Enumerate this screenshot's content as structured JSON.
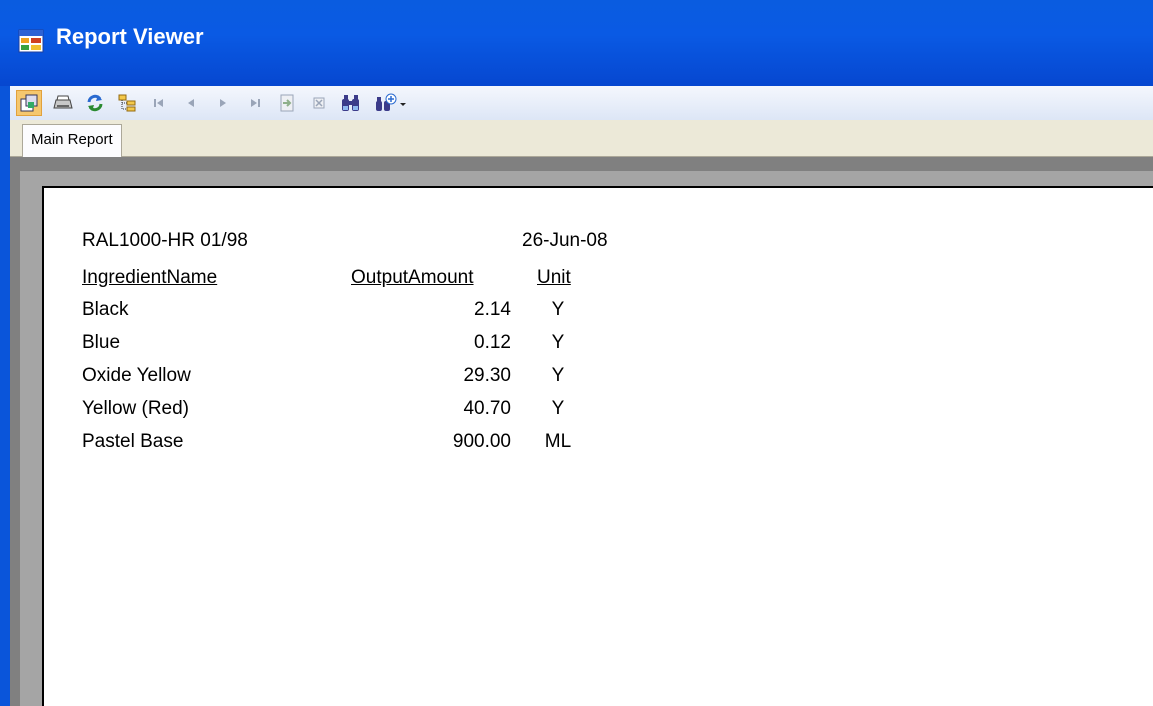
{
  "window": {
    "title": "Report Viewer"
  },
  "toolbar": {
    "buttons": [
      "export-icon",
      "print-icon",
      "refresh-icon",
      "group-tree-icon",
      "first-page-icon",
      "previous-page-icon",
      "next-page-icon",
      "last-page-icon",
      "goto-page-icon",
      "stop-icon",
      "find-icon",
      "zoom-icon"
    ]
  },
  "tabs": [
    {
      "label": "Main Report"
    }
  ],
  "report": {
    "code": "RAL1000-HR 01/98",
    "date": "26-Jun-08",
    "headers": {
      "ingredient": "IngredientName",
      "amount": "OutputAmount",
      "unit": "Unit"
    },
    "rows": [
      {
        "ingredient": "Black",
        "amount": "2.14",
        "unit": "Y"
      },
      {
        "ingredient": "Blue",
        "amount": "0.12",
        "unit": "Y"
      },
      {
        "ingredient": "Oxide Yellow",
        "amount": "29.30",
        "unit": "Y"
      },
      {
        "ingredient": "Yellow (Red)",
        "amount": "40.70",
        "unit": "Y"
      },
      {
        "ingredient": "Pastel Base",
        "amount": "900.00",
        "unit": "ML"
      }
    ]
  }
}
